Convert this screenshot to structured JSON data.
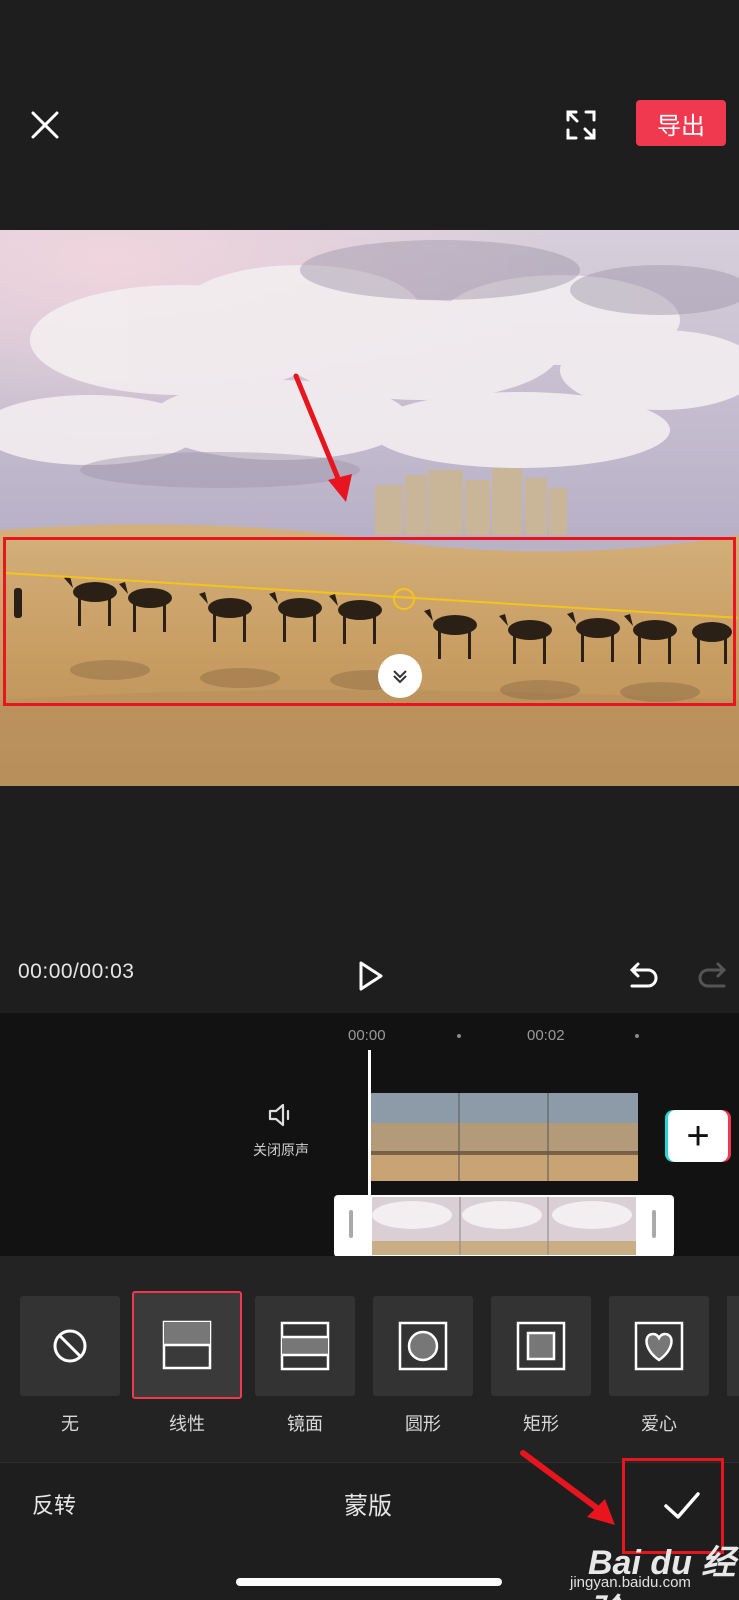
{
  "top_bar": {
    "close_icon": "close-icon",
    "fullscreen_icon": "fullscreen-icon",
    "export_label": "导出",
    "export_color": "#f0394f"
  },
  "player": {
    "timecode": "00:00/00:03",
    "play_icon": "play-icon",
    "undo_icon": "undo-icon",
    "redo_icon": "redo-icon"
  },
  "timeline": {
    "ruler": [
      "00:00",
      "00:02"
    ],
    "mute_label": "关闭原声",
    "mute_icon": "speaker-icon",
    "add_icon": "plus-icon"
  },
  "mask_options": [
    {
      "label": "无",
      "icon": "none-icon",
      "selected": false
    },
    {
      "label": "线性",
      "icon": "linear-mask-icon",
      "selected": true
    },
    {
      "label": "镜面",
      "icon": "mirror-mask-icon",
      "selected": false
    },
    {
      "label": "圆形",
      "icon": "circle-mask-icon",
      "selected": false
    },
    {
      "label": "矩形",
      "icon": "rectangle-mask-icon",
      "selected": false
    },
    {
      "label": "爱心",
      "icon": "heart-mask-icon",
      "selected": false
    }
  ],
  "bottom_bar": {
    "invert_label": "反转",
    "title": "蒙版",
    "confirm_icon": "checkmark-icon"
  },
  "watermark": {
    "text": "Bai du 经验",
    "url": "jingyan.baidu.com"
  },
  "annotation_color": "#e8141e",
  "accent_line_color": "#f4c31c"
}
